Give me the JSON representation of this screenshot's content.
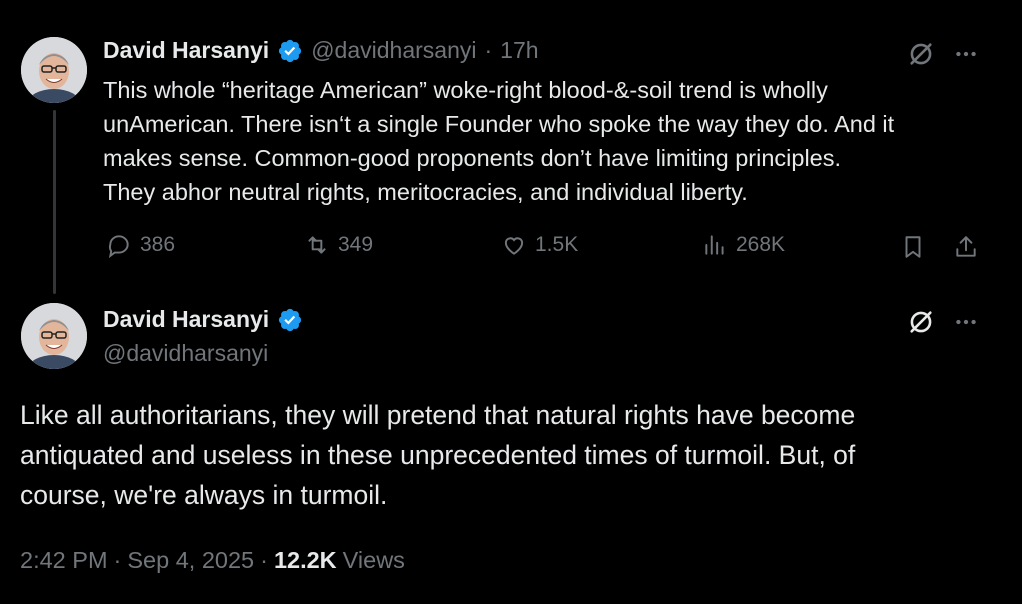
{
  "reply_parent": {
    "display_name": "David Harsanyi",
    "handle": "@davidharsanyi",
    "separator": "·",
    "time_ago": "17h",
    "text_lines": [
      "This whole “heritage American” woke-right blood-&-soil trend is wholly",
      "unAmerican. There isn‘t a single Founder who spoke the way they do. And it",
      "makes sense. Common-good proponents don’t have limiting principles.",
      "They abhor neutral rights, meritocracies, and individual liberty."
    ],
    "stats": {
      "replies": "386",
      "reposts": "349",
      "likes": "1.5K",
      "views": "268K"
    }
  },
  "main_tweet": {
    "display_name": "David Harsanyi",
    "handle": "@davidharsanyi",
    "text_lines": [
      "Like all authoritarians, they will pretend that natural rights have become",
      "antiquated and useless in these unprecedented times of turmoil. But, of",
      "course, we're always in turmoil."
    ],
    "time": "2:42 PM",
    "date": "Sep 4, 2025",
    "view_count": "12.2K",
    "views_label": "Views",
    "separator": "·"
  },
  "icons": {
    "verified": "verified-badge-icon",
    "grok": "grok-icon",
    "more": "more-icon",
    "reply": "reply-icon",
    "repost": "repost-icon",
    "like": "like-icon",
    "views": "views-icon",
    "bookmark": "bookmark-icon",
    "share": "share-icon"
  },
  "colors": {
    "background": "#000000",
    "text": "#e7e9ea",
    "muted": "#71767b",
    "verified": "#1d9bf0"
  }
}
